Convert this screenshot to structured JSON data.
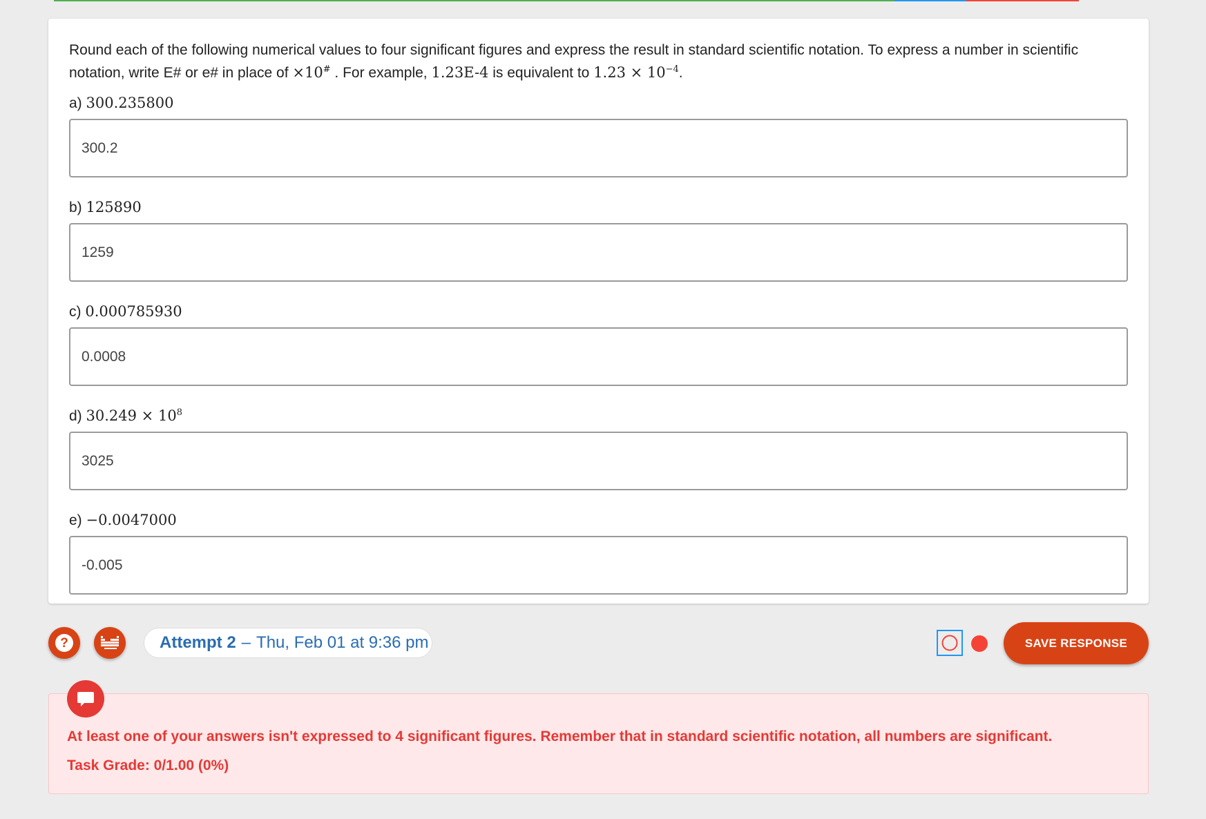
{
  "prompt": {
    "text_1": "Round each of the following numerical values to four significant figures and express the result in standard scientific notation. To express a number in scientific notation, write E# or e# in place of ",
    "times_ten": "×10",
    "hash_sup": "#",
    "text_2": " . For example, ",
    "example": "1.23E-4",
    "text_3": " is equivalent to ",
    "example_math": "1.23 × 10",
    "example_sup": "−4",
    "text_4": "."
  },
  "questions": [
    {
      "letter": "a)",
      "value": "300.235800",
      "answer": "300.2"
    },
    {
      "letter": "b)",
      "value": "125890",
      "answer": "1259"
    },
    {
      "letter": "c)",
      "value": "0.000785930",
      "answer": "0.0008"
    },
    {
      "letter": "d)",
      "value": "30.249 × 10",
      "value_sup": "8",
      "answer": "3025"
    },
    {
      "letter": "e)",
      "value": "−0.0047000",
      "answer": "-0.005"
    }
  ],
  "attempt": {
    "label": "Attempt 2",
    "dash": "–",
    "date": "Thu, Feb 01 at 9:36 pm"
  },
  "save_button": "SAVE RESPONSE",
  "feedback": {
    "message": "At least one of your answers isn't expressed to 4 significant figures. Remember that in standard scientific notation, all numbers are significant.",
    "grade": "Task Grade: 0/1.00 (0%)"
  },
  "colors": {
    "accent": "#d84315",
    "link": "#2a6db0",
    "error": "#e53935",
    "error_bg": "#ffe8e9"
  },
  "icons": {
    "help": "help-icon",
    "periodic_table": "periodic-table-icon",
    "record": "record-icon",
    "feedback": "comment-icon"
  }
}
